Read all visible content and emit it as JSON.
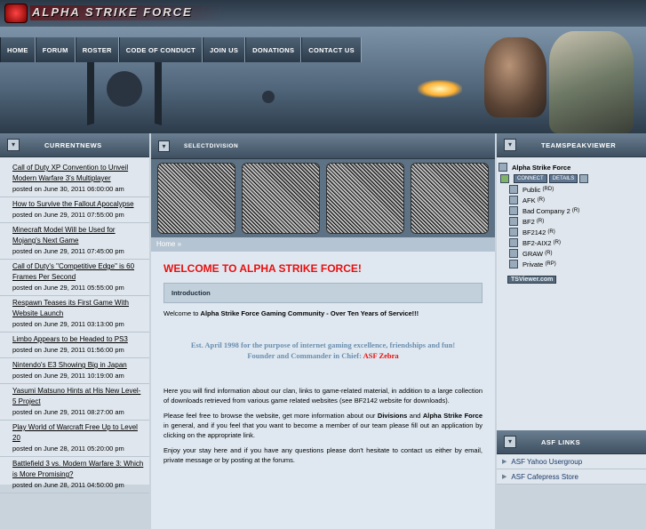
{
  "site": {
    "logo_text": "ALPHA STRIKE FORCE"
  },
  "nav": [
    "HOME",
    "FORUM",
    "ROSTER",
    "CODE OF CONDUCT",
    "JOIN US",
    "DONATIONS",
    "CONTACT US"
  ],
  "left_panel": {
    "title": "CURRENTNEWS",
    "items": [
      {
        "title": "Call of Duty XP Convention to Unveil Modern Warfare 3's Multiplayer",
        "date": "posted on June 30, 2011 06:00:00 am"
      },
      {
        "title": "How to Survive the Fallout Apocalypse",
        "date": "posted on June 29, 2011 07:55:00 pm"
      },
      {
        "title": "Minecraft Model Will be Used for Mojang's Next Game",
        "date": "posted on June 29, 2011 07:45:00 pm"
      },
      {
        "title": "Call of Duty's \"Competitive Edge\" is 60 Frames Per Second",
        "date": "posted on June 29, 2011 05:55:00 pm"
      },
      {
        "title": "Respawn Teases its First Game With Website Launch",
        "date": "posted on June 29, 2011 03:13:00 pm"
      },
      {
        "title": "Limbo Appears to be Headed to PS3",
        "date": "posted on June 29, 2011 01:56:00 pm"
      },
      {
        "title": "Nintendo's E3 Showing Big in Japan",
        "date": "posted on June 29, 2011 10:19:00 am"
      },
      {
        "title": "Yasumi Matsuno Hints at His New Level-5 Project",
        "date": "posted on June 29, 2011 08:27:00 am"
      },
      {
        "title": "Play World of Warcraft Free Up to Level 20",
        "date": "posted on June 28, 2011 05:20:00 pm"
      },
      {
        "title": "Battlefield 3 vs. Modern Warfare 3: Which is More Promising?",
        "date": "posted on June 28, 2011 04:50:00 pm"
      }
    ]
  },
  "middle": {
    "division_title": "SELECTDIVISION",
    "breadcrumb": "Home »",
    "welcome": "WELCOME TO ALPHA STRIKE FORCE!",
    "intro_heading": "Introduction",
    "welcome_line_prefix": "Welcome to ",
    "welcome_line_bold": "Alpha Strike Force Gaming Community - Over Ten Years of Service!!!",
    "est_line1": "Est. April 1998 for the purpose of internet gaming excellence, friendships and fun!",
    "est_line2_prefix": "Founder and Commander in Chief: ",
    "est_founder": "ASF Zebra",
    "para1": "Here you will find information about our clan, links to game-related material, in addition to a large collection of downloads retrieved from various game related websites (see BF2142 website for downloads).",
    "para2_a": "Please feel free to browse the website, get more information about our ",
    "para2_b": "Divisions",
    "para2_c": " and ",
    "para2_d": "Alpha Strike Force",
    "para2_e": " in general, and if you feel that you want to become a member of our team please fill out an application by clicking on the appropriate link.",
    "para3": "Enjoy your stay here and if you have any questions please don't hesitate to contact us either by email, private message or by posting at the forums."
  },
  "right_panel": {
    "title": "TEAMSPEAKVIEWER",
    "server_name": "Alpha Strike Force",
    "connect_label": "CONNECT",
    "details_label": "DETAILS",
    "channels": [
      {
        "name": "Public",
        "flag": "(RD)"
      },
      {
        "name": "AFK",
        "flag": "(R)"
      },
      {
        "name": "Bad Company 2",
        "flag": "(R)"
      },
      {
        "name": "BF2",
        "flag": "(R)"
      },
      {
        "name": "BF2142",
        "flag": "(R)"
      },
      {
        "name": "BF2-AIX2",
        "flag": "(R)"
      },
      {
        "name": "GRAW",
        "flag": "(R)"
      },
      {
        "name": "Private",
        "flag": "(RP)"
      }
    ],
    "tsviewer_label": "TSViewer.com",
    "links_title": "ASF LINKS",
    "links": [
      "ASF Yahoo Usergroup",
      "ASF Cafepress Store"
    ]
  },
  "colors": {
    "accent_red": "#e81010",
    "panel_header": "#3e5061"
  }
}
